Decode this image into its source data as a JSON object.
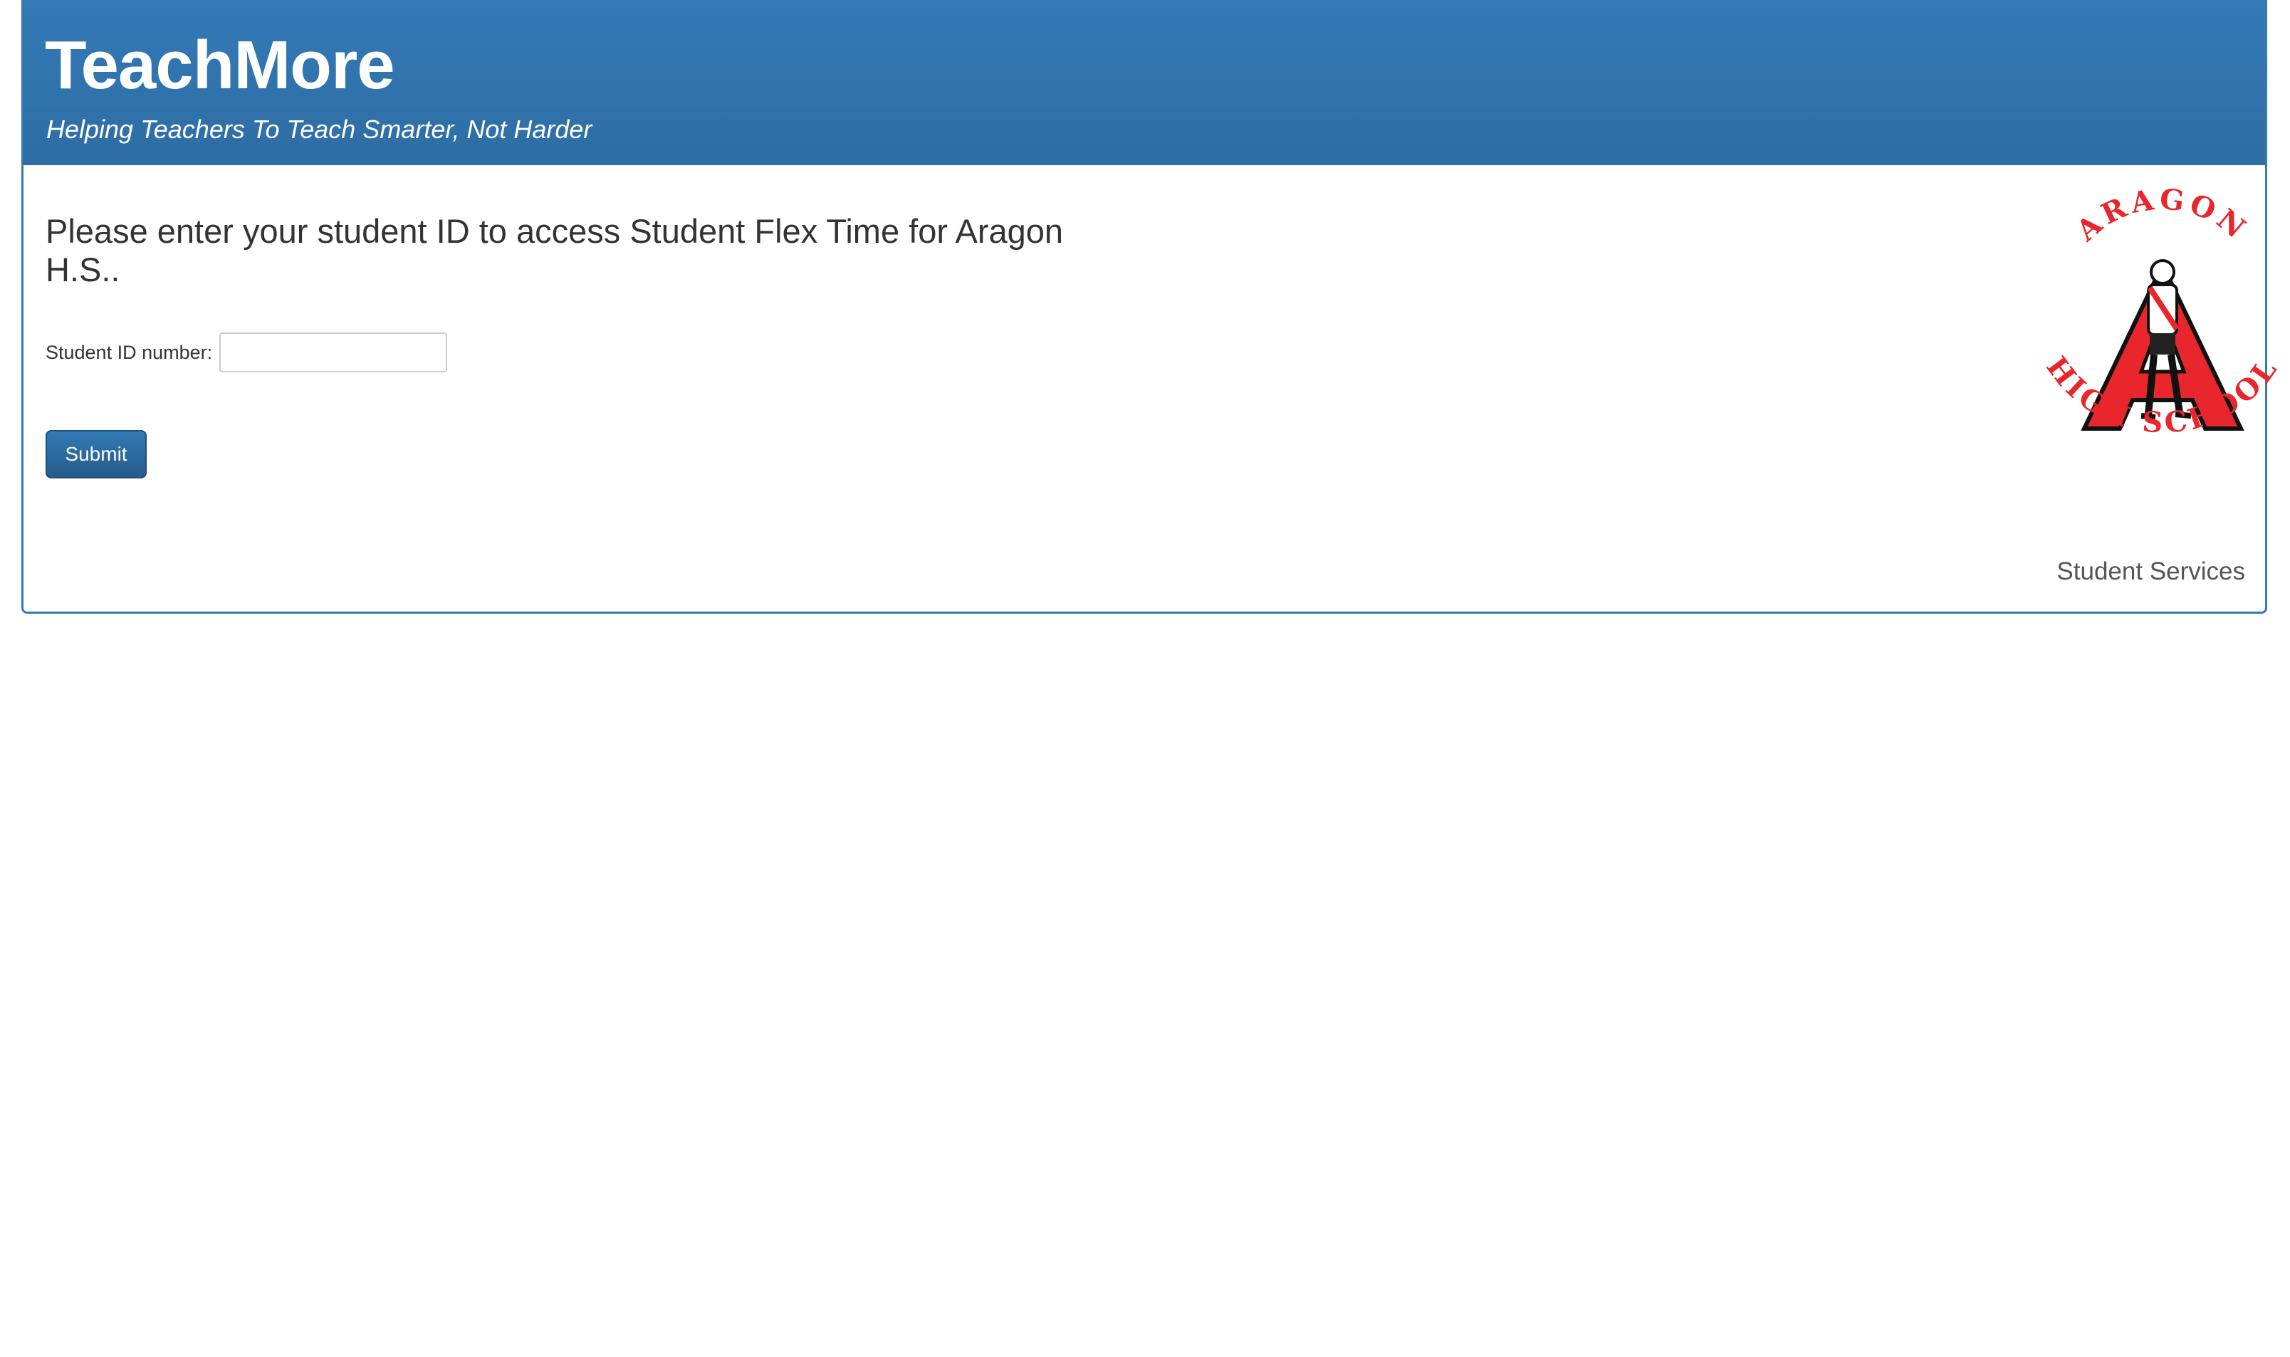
{
  "header": {
    "brand": "TeachMore",
    "tagline": "Helping Teachers To Teach Smarter, Not Harder"
  },
  "main": {
    "heading": "Please enter your student ID to access Student Flex Time for Aragon H.S..",
    "student_id_label": "Student ID number:",
    "student_id_value": "",
    "submit_label": "Submit"
  },
  "logo": {
    "top_text": "ARAGON",
    "bottom_text": "HIGH SCHOOL",
    "letter": "A",
    "colors": {
      "red": "#e8262b",
      "dark": "#111111"
    }
  },
  "footer": {
    "text": "Student Services"
  },
  "colors": {
    "header_blue": "#337ab7",
    "button_blue": "#2e6da4"
  }
}
